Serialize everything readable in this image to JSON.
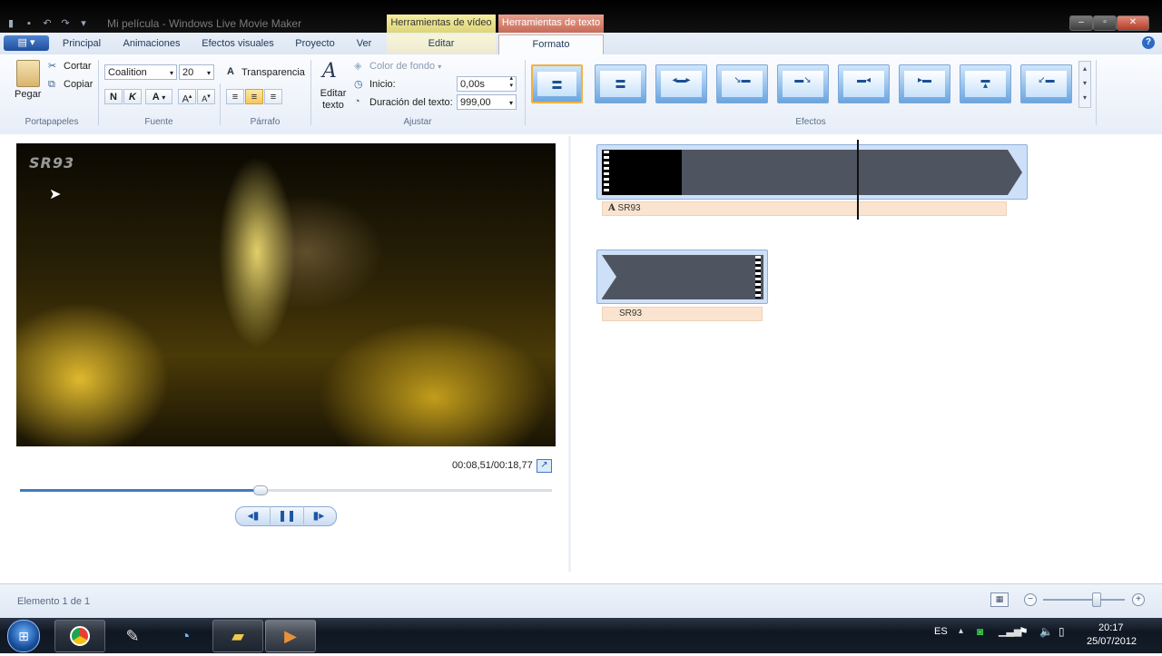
{
  "window": {
    "title": "Mi película - Windows Live Movie Maker"
  },
  "context_tabs": {
    "video_tools": "Herramientas de vídeo",
    "text_tools": "Herramientas de texto"
  },
  "tabs": [
    {
      "label": "Principal"
    },
    {
      "label": "Animaciones"
    },
    {
      "label": "Efectos visuales"
    },
    {
      "label": "Proyecto"
    },
    {
      "label": "Ver"
    },
    {
      "label": "Editar"
    },
    {
      "label": "Formato"
    }
  ],
  "ribbon": {
    "clipboard": {
      "paste": "Pegar",
      "cut": "Cortar",
      "copy": "Copiar",
      "group": "Portapapeles"
    },
    "font": {
      "family": "Coalition",
      "size": "20",
      "bold": "N",
      "italic": "K",
      "color": "A",
      "grow": "A",
      "shrink": "A",
      "transparency": "Transparencia",
      "group": "Fuente"
    },
    "paragraph": {
      "group": "Párrafo"
    },
    "adjust": {
      "edit_text": "Editar texto",
      "bg_color": "Color de fondo",
      "start_label": "Inicio:",
      "start_value": "0,00s",
      "duration_label": "Duración del texto:",
      "duration_value": "999,00",
      "group": "Ajustar"
    },
    "effects": {
      "group": "Efectos"
    }
  },
  "preview": {
    "watermark": "SR93",
    "timecode": "00:08,51/00:18,77",
    "progress": 0.45
  },
  "timeline": {
    "clip1_caption": "SR93",
    "clip2_caption": "SR93"
  },
  "status": {
    "text": "Elemento 1 de 1"
  },
  "taskbar": {
    "lang": "ES",
    "time": "20:17",
    "date": "25/07/2012"
  },
  "colors": {
    "accent": "#3f7bc6",
    "text_tools": "#c76a58",
    "video_tools": "#dcd57a"
  }
}
